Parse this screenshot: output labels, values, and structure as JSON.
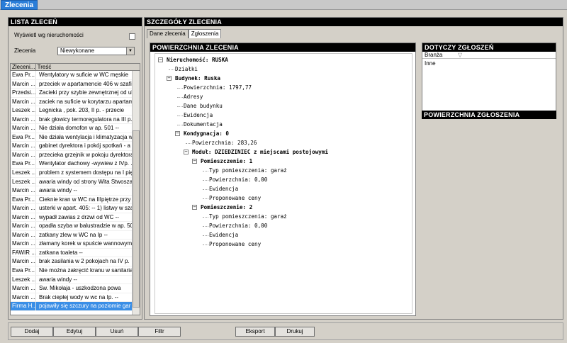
{
  "app": {
    "tab": "Zlecenia"
  },
  "left": {
    "header": "LISTA ZLECEŃ",
    "show_by_property_label": "Wyświetl wg nieruchomości",
    "orders_label": "Zlecenia",
    "orders_value": "Niewykonane",
    "columns": [
      "Zleceni...",
      "Treść"
    ],
    "rows": [
      {
        "c1": "Ewa Pr...",
        "c2": "Wentylatory w suficie  w WC męskie"
      },
      {
        "c1": "Marcin ...",
        "c2": "przeciek w apartamencie 406 w szafi"
      },
      {
        "c1": "Przedsi...",
        "c2": "Zacieki przy szybie zewnętrznej od ul"
      },
      {
        "c1": "Marcin ...",
        "c2": "zaciek na suficie w korytarzu apartam"
      },
      {
        "c1": "Leszek ...",
        "c2": "Legnicka    , pok. 203, II p. - przecie"
      },
      {
        "c1": "Marcin ...",
        "c2": "brak głowicy termoregulatora na III p."
      },
      {
        "c1": "Marcin ...",
        "c2": "Nie działa domofon w ap. 501 --"
      },
      {
        "c1": "Ewa Pr...",
        "c2": "Nie działa wentylacja i klimatyzacja w"
      },
      {
        "c1": "Marcin ...",
        "c2": "gabinet dyrektora i pokój spotkań - a"
      },
      {
        "c1": "Marcin ...",
        "c2": "przecieka grzejnik w pokoju dyrektora"
      },
      {
        "c1": "Ewa Pr...",
        "c2": "Wentylator dachowy -wywiew z IVp. ."
      },
      {
        "c1": "Leszek ...",
        "c2": "problem z systemem dostępu na I pię"
      },
      {
        "c1": "Leszek ...",
        "c2": "awaria windy od strony Wita Stwosza"
      },
      {
        "c1": "Marcin ...",
        "c2": "awaria windy --"
      },
      {
        "c1": "Ewa Pr...",
        "c2": "Cieknie kran w WC na IIIpiętrze przy"
      },
      {
        "c1": "Marcin ...",
        "c2": "usterki w apart. 405: -- 1) listwy w sza"
      },
      {
        "c1": "Marcin ...",
        "c2": "wypadł zawias z drzwi od WC --"
      },
      {
        "c1": "Marcin ...",
        "c2": "opadła szyba w balustradzie w ap. 50"
      },
      {
        "c1": "Marcin ...",
        "c2": "zatkany zlew w WC na Ip --"
      },
      {
        "c1": "Marcin ...",
        "c2": "złamany korek w spuście wannowym"
      },
      {
        "c1": "FAWIR ...",
        "c2": "zatkana toaleta  --"
      },
      {
        "c1": "Marcin ...",
        "c2": "brak zasilania w 2 pokojach na IV p."
      },
      {
        "c1": "Ewa Pr...",
        "c2": "Nie można zakręcić kranu w sanitaria"
      },
      {
        "c1": "Leszek ...",
        "c2": "awaria windy --"
      },
      {
        "c1": "Marcin ...",
        "c2": "Sw. Mikołaja      - uszkodzona powa"
      },
      {
        "c1": "Marcin ...",
        "c2": "Brak ciepłej wody w wc na Ip. --"
      },
      {
        "c1": "Firma H...",
        "c2": "pojawiły się szczury na poziomie gar"
      }
    ]
  },
  "right": {
    "header": "SZCZEGÓŁY ZLECENIA",
    "tabs": [
      "Dane zlecenia",
      "Zgłoszenia"
    ],
    "tree_header": "POWIERZCHNIA ZLECENIA",
    "tree": [
      {
        "text": "Nieruchomość: RUSKA",
        "bold": true,
        "level": 0,
        "exp": true
      },
      {
        "text": "Działki",
        "level": 1
      },
      {
        "text": "Budynek: Ruska",
        "bold": true,
        "level": 1,
        "exp": true
      },
      {
        "text": "Powierzchnia: 1797,77",
        "level": 2
      },
      {
        "text": "Adresy",
        "level": 2
      },
      {
        "text": "Dane budynku",
        "level": 2
      },
      {
        "text": "Ewidencja",
        "level": 2
      },
      {
        "text": "Dokumentacja",
        "level": 2
      },
      {
        "text": "Kondygnacja: 0",
        "bold": true,
        "level": 2,
        "exp": true
      },
      {
        "text": "Powierzchnia: 283,26",
        "level": 3
      },
      {
        "text": "Moduł: DZIEDZINIEC z miejscami postojowymi",
        "bold": true,
        "level": 3,
        "exp": true
      },
      {
        "text": "Pomieszczenie: 1",
        "bold": true,
        "level": 4,
        "exp": true
      },
      {
        "text": "Typ pomieszczenia: garaż",
        "level": 5
      },
      {
        "text": "Powierzchnia: 0,00",
        "level": 5
      },
      {
        "text": "Ewidencja",
        "level": 5
      },
      {
        "text": "Proponowane ceny",
        "level": 5
      },
      {
        "text": "Pomieszczenie: 2",
        "bold": true,
        "level": 4,
        "exp": true
      },
      {
        "text": "Typ pomieszczenia: garaż",
        "level": 5
      },
      {
        "text": "Powierzchnia: 0,00",
        "level": 5
      },
      {
        "text": "Ewidencja",
        "level": 5
      },
      {
        "text": "Proponowane ceny",
        "level": 5
      }
    ],
    "side_header": "DOTYCZY ZGŁOSZEŃ",
    "side_column": "Branża",
    "side_value": "Inne",
    "side_header2": "POWIERZCHNIA ZGŁOSZENIA"
  },
  "toolbar": {
    "add": "Dodaj",
    "edit": "Edytuj",
    "delete": "Usuń",
    "filter": "Filtr",
    "export": "Eksport",
    "print": "Drukuj"
  },
  "colors": {
    "selection": "#3a8ee6",
    "app_tab": "#2a7dd8",
    "header": "#000000"
  },
  "icons": {
    "combo": "chevron-down-icon",
    "filter": "filter-icon"
  }
}
